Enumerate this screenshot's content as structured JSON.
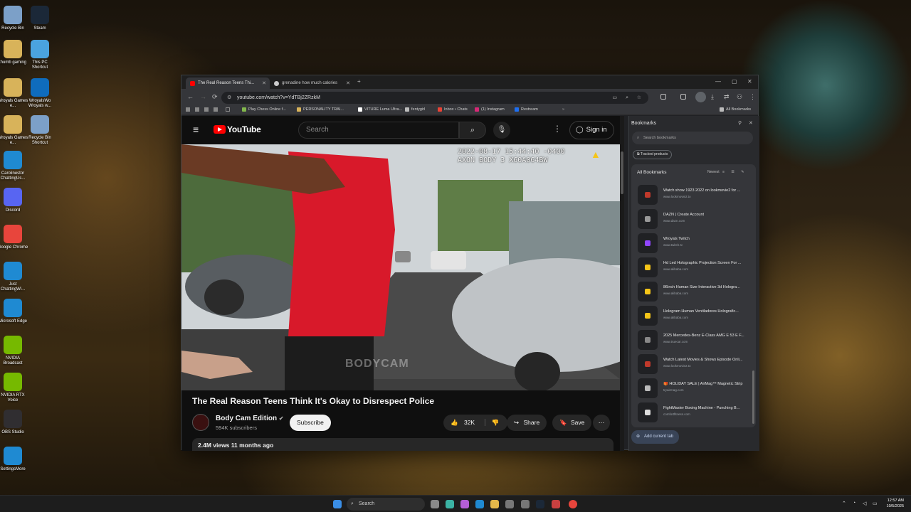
{
  "desktop": {
    "icons": [
      {
        "label": "Recycle Bin",
        "color": "#7ca0c8"
      },
      {
        "label": "Steam",
        "color": "#1b2838"
      },
      {
        "label": "thumb gaming",
        "color": "#d8b35a"
      },
      {
        "label": "This PC Shortcut",
        "color": "#4aa3df"
      },
      {
        "label": "Wroyals Games e...",
        "color": "#d8b35a"
      },
      {
        "label": "WroyalsWo Wroyals w...",
        "color": "#0f6cbd"
      },
      {
        "label": "Wroyals Games e...",
        "color": "#d8b35a"
      },
      {
        "label": "Recycle Bin Shortcut",
        "color": "#7ca0c8"
      },
      {
        "label": "Carolinestor ChattingUs...",
        "color": "#1f8ad2"
      },
      {
        "label": "Discord",
        "color": "#5865f2"
      },
      {
        "label": "Google Chrome",
        "color": "#e8453c"
      },
      {
        "label": "Just ChattingWi...",
        "color": "#1f8ad2"
      },
      {
        "label": "Microsoft Edge",
        "color": "#1f8ad2"
      },
      {
        "label": "NVIDIA Broadcast",
        "color": "#76b900"
      },
      {
        "label": "NVIDIA RTX Voice",
        "color": "#76b900"
      },
      {
        "label": "OBS Studio",
        "color": "#302e31"
      },
      {
        "label": "SettingsMore",
        "color": "#1f8ad2"
      }
    ]
  },
  "browser": {
    "tabs": [
      {
        "title": "The Real Reason Teens Thi...",
        "active": true,
        "favicon_color": "#ff0000"
      },
      {
        "title": "grenadine how much calories",
        "active": false,
        "favicon_color": "#cccccc"
      }
    ],
    "new_tab": "+",
    "url": "youtube.com/watch?v=YdTBj2ZRzkM",
    "bookmarks_bar": [
      {
        "label": "Play Chess Online f...",
        "color": "#81b64c"
      },
      {
        "label": "PERSONALITY TRAI...",
        "color": "#d8b35a"
      },
      {
        "label": "VITURE Luma Ultra...",
        "color": "#ffffff"
      },
      {
        "label": "fentygirl",
        "color": "#bbbbbb"
      },
      {
        "label": "Inbox • Chats",
        "color": "#e94235"
      },
      {
        "label": "(1) Instagram",
        "color": "#d62976"
      },
      {
        "label": "Restream",
        "color": "#1e6ff1"
      }
    ],
    "all_bookmarks": "All Bookmarks"
  },
  "youtube": {
    "logo": "YouTube",
    "search_placeholder": "Search",
    "sign_in": "Sign in",
    "osd_line1": "2022-08-17 15:44:40 -0400",
    "osd_line2": "AXON BODY 3 X60A064BW",
    "watermark": "BODYCAM",
    "video_title": "The Real Reason Teens Think It's Okay to Disrespect Police",
    "channel_name": "Body Cam Edition",
    "subscribers": "594K subscribers",
    "subscribe": "Subscribe",
    "likes": "32K",
    "share": "Share",
    "save": "Save",
    "views_age": "2.4M views  11 months ago"
  },
  "bookmarks_panel": {
    "title": "Bookmarks",
    "search_placeholder": "Search bookmarks",
    "chip": "Tracked products",
    "list_title": "All Bookmarks",
    "sort": "Newest",
    "items": [
      {
        "title": "Watch show 1923 2022 on lookmovie2 for ...",
        "url": "www.lookmovie2.to",
        "color": "#c0392b"
      },
      {
        "title": "DAZN | Create Account",
        "url": "www.dazn.com",
        "color": "#999999"
      },
      {
        "title": "Wroyals Twitch",
        "url": "www.twitch.tv",
        "color": "#9146ff"
      },
      {
        "title": "Hd Led Holographic Projection Screen For ...",
        "url": "www.alibaba.com",
        "color": "#f5c518"
      },
      {
        "title": "86inch Human Size Interactive 3d Hologra...",
        "url": "www.alibaba.com",
        "color": "#f5c518"
      },
      {
        "title": "Hologram Human Ventiladores Holografic...",
        "url": "www.alibaba.com",
        "color": "#f5c518"
      },
      {
        "title": "2025 Mercedes-Benz E-Class AMG E 53 E F...",
        "url": "www.truecar.com",
        "color": "#888888"
      },
      {
        "title": "Watch Latest Movies & Shows Episode Onli...",
        "url": "www.lookmovie2.to",
        "color": "#c0392b"
      },
      {
        "title": "🎁 HOLIDAY SALE | AirMag™ Magnetic Strip",
        "url": "tryairmag.com",
        "color": "#bbbbbb"
      },
      {
        "title": "FightMaster Boxing Machine - Punching B...",
        "url": "comfortfitness.com",
        "color": "#dddddd"
      }
    ],
    "add_current_tab": "Add current tab"
  },
  "taskbar": {
    "search": "Search",
    "time": "12:57 AM",
    "date": "10/5/2025"
  }
}
